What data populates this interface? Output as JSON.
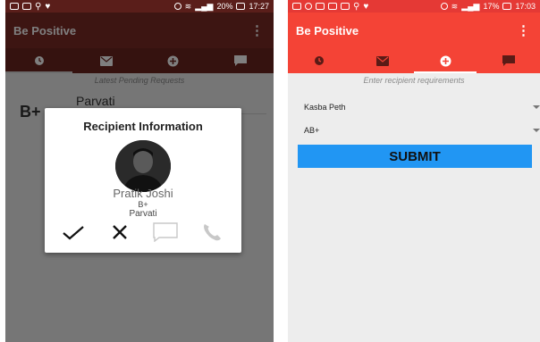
{
  "left": {
    "status": {
      "battery": "20%",
      "time": "17:27"
    },
    "app_title": "Be Positive",
    "menu_glyph": "⋮",
    "tabs": [
      {
        "icon": "history-icon"
      },
      {
        "icon": "mail-icon"
      },
      {
        "icon": "add-icon"
      },
      {
        "icon": "chat-icon"
      }
    ],
    "list_header": "Latest Pending Requests",
    "request": {
      "blood_group": "B+",
      "name": "Parvati"
    },
    "dialog": {
      "title": "Recipient Information",
      "name": "Pratik Joshi",
      "blood_group": "B+",
      "location": "Parvati",
      "actions": [
        "check-icon",
        "close-icon",
        "message-icon",
        "phone-icon"
      ]
    },
    "colors": {
      "appbar": "#7a2a25",
      "tabbar": "#6a241f",
      "statusbar": "#5a1e1a"
    }
  },
  "right": {
    "status": {
      "battery": "17%",
      "time": "17:03"
    },
    "app_title": "Be Positive",
    "menu_glyph": "⋮",
    "tabs": [
      {
        "icon": "history-icon"
      },
      {
        "icon": "mail-icon"
      },
      {
        "icon": "add-icon"
      },
      {
        "icon": "chat-icon"
      }
    ],
    "list_header": "Enter recipient requirements",
    "location_select": "Kasba Peth",
    "blood_select": "AB+",
    "submit_label": "SUBMIT",
    "colors": {
      "appbar": "#f44336",
      "statusbar": "#e53935",
      "submit": "#2196f3"
    }
  }
}
